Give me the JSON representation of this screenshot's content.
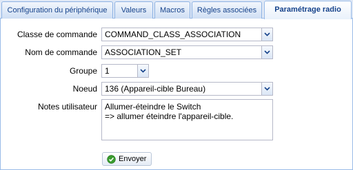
{
  "tabs": [
    {
      "label": "Configuration du périphérique",
      "active": false
    },
    {
      "label": "Valeurs",
      "active": false
    },
    {
      "label": "Macros",
      "active": false
    },
    {
      "label": "Règles associées",
      "active": false
    },
    {
      "label": "Paramétrage radio",
      "active": true
    }
  ],
  "form": {
    "command_class": {
      "label": "Classe de commande",
      "value": "COMMAND_CLASS_ASSOCIATION"
    },
    "command_name": {
      "label": "Nom de commande",
      "value": "ASSOCIATION_SET"
    },
    "group": {
      "label": "Groupe",
      "value": "1"
    },
    "node": {
      "label": "Noeud",
      "value": "136 (Appareil-cible Bureau)"
    },
    "notes": {
      "label": "Notes utilisateur",
      "value": "Allumer-éteindre le Switch\n=> allumer éteindre l'appareil-cible."
    }
  },
  "submit_label": "Envoyer",
  "icons": {
    "dropdown": "chevron-down-icon",
    "submit": "check-circle-icon"
  },
  "colors": {
    "tab_text": "#15428b",
    "border": "#99bbe8",
    "field_border": "#b5b8c8",
    "check": "#3a9d2f"
  }
}
